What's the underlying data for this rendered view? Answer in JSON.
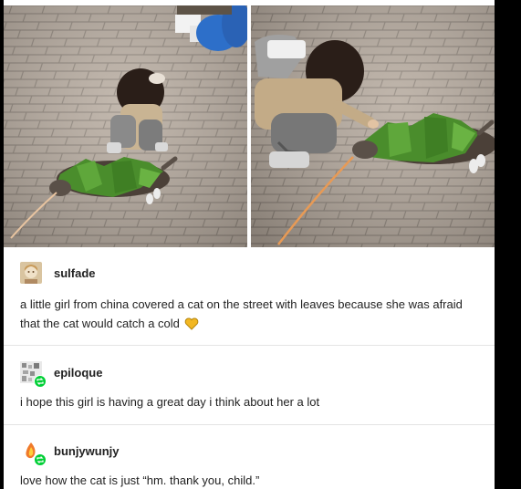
{
  "post": {
    "photos": [
      {
        "alt": "girl-covering-cat-with-leaves-left"
      },
      {
        "alt": "girl-covering-cat-with-leaves-right"
      }
    ],
    "replies": [
      {
        "username": "sulfade",
        "text": "a little girl from china covered a cat on the street with leaves because she was afraid that the cat would catch a cold",
        "emoji": "yellow-heart-icon"
      },
      {
        "username": "epiloque",
        "text": "i hope this girl is having a great day i think about her a lot"
      },
      {
        "username": "bunjywunjy",
        "text": "love how the cat is just “hm. thank you, child.”"
      }
    ]
  },
  "colors": {
    "background": "#000000",
    "card": "#ffffff",
    "text": "#222222",
    "heart": "#f2b722",
    "reblog_badge": "#00cf35"
  }
}
